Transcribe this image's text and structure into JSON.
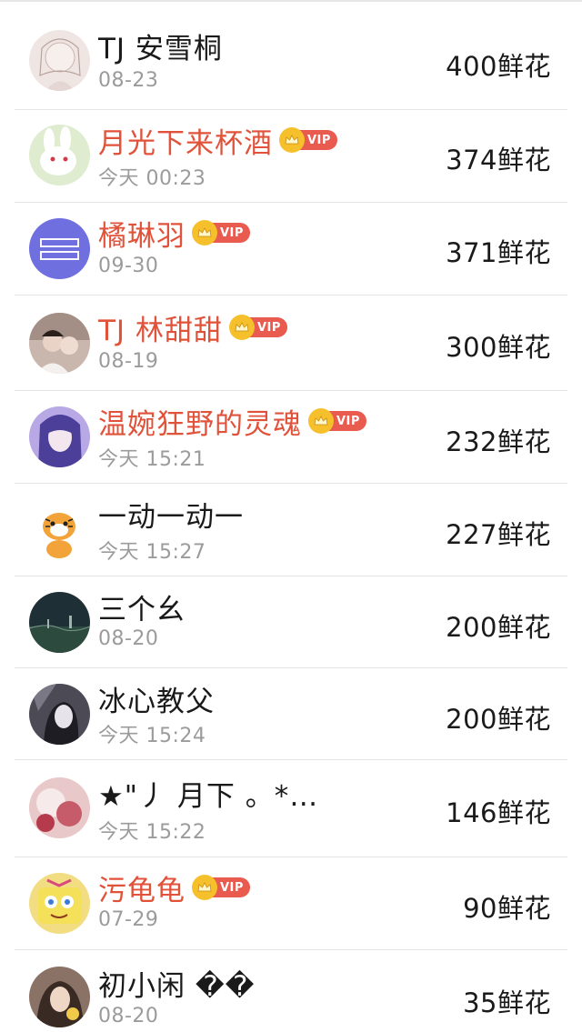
{
  "rows": [
    {
      "name": "TJ 安雪桐",
      "date": "08-23",
      "amount": "400鲜花",
      "vip": false,
      "avatar_icon": "anime-girl-sketch-avatar",
      "avatar_color": "#efe6e4"
    },
    {
      "name": "月光下来杯酒",
      "date": "今天 00:23",
      "amount": "374鲜花",
      "vip": true,
      "vip_label": "VIP",
      "avatar_icon": "white-rabbit-avatar",
      "avatar_color": "#dfeccf"
    },
    {
      "name": "橘琳羽",
      "date": "09-30",
      "amount": "371鲜花",
      "vip": true,
      "vip_label": "VIP",
      "avatar_icon": "text-logo-avatar",
      "avatar_color": "#6f6fe0"
    },
    {
      "name": "TJ 林甜甜",
      "date": "08-19",
      "amount": "300鲜花",
      "vip": true,
      "vip_label": "VIP",
      "avatar_icon": "couple-photo-avatar",
      "avatar_color": "#c9b6ad"
    },
    {
      "name": "温婉狂野的灵魂",
      "date": "今天 15:21",
      "amount": "232鲜花",
      "vip": true,
      "vip_label": "VIP",
      "avatar_icon": "anime-girl-purple-avatar",
      "avatar_color": "#b9a8e6"
    },
    {
      "name": "一动一动一",
      "date": "今天 15:27",
      "amount": "227鲜花",
      "vip": false,
      "avatar_icon": "tiger-cartoon-avatar",
      "avatar_color": "#ffffff"
    },
    {
      "name": "三个幺",
      "date": "08-20",
      "amount": "200鲜花",
      "vip": false,
      "avatar_icon": "dark-landscape-avatar",
      "avatar_color": "#1f2f36"
    },
    {
      "name": "冰心教父",
      "date": "今天 15:24",
      "amount": "200鲜花",
      "vip": false,
      "avatar_icon": "dark-portrait-avatar",
      "avatar_color": "#4c4a55"
    },
    {
      "name": "★\"丿 月下 。*…",
      "date": "今天 15:22",
      "amount": "146鲜花",
      "vip": false,
      "avatar_icon": "pink-photo-avatar",
      "avatar_color": "#e8c8c8"
    },
    {
      "name": "污龟龟",
      "date": "07-29",
      "amount": "90鲜花",
      "vip": true,
      "vip_label": "VIP",
      "avatar_icon": "sponge-cartoon-avatar",
      "avatar_color": "#f2dd83"
    },
    {
      "name": "初小闲 ��",
      "date": "08-20",
      "amount": "35鲜花",
      "vip": false,
      "avatar_icon": "girl-photo-avatar",
      "avatar_color": "#8b7266"
    }
  ],
  "colors": {
    "vip_name": "#e0533a",
    "vip_badge": "#e95a4f",
    "vip_crown": "#f5c02b",
    "date": "#9b9b9b",
    "divider": "#e4e4e4"
  }
}
